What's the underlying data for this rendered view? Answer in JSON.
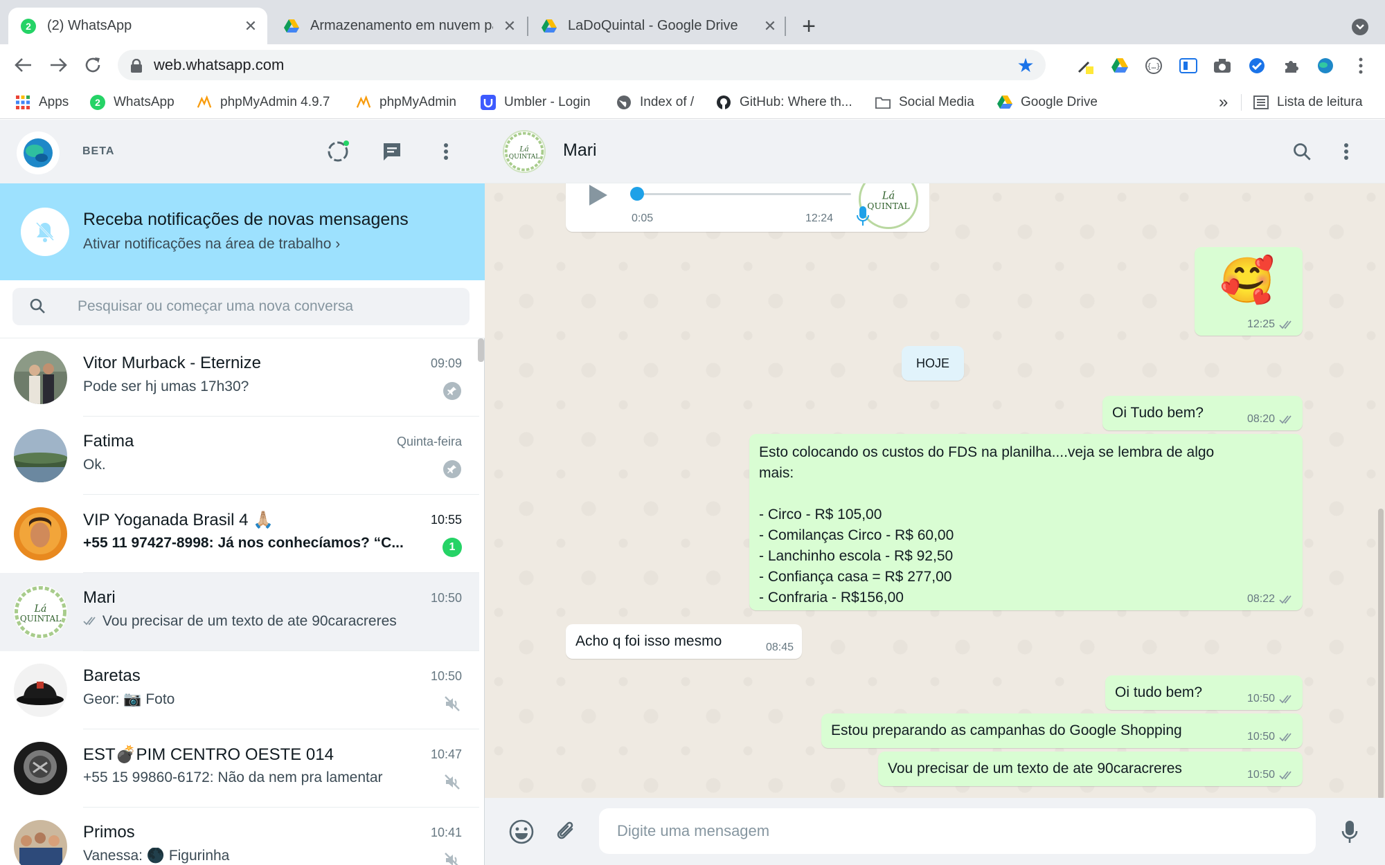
{
  "browser": {
    "tabs": [
      {
        "title": "(2) WhatsApp",
        "badge": "2",
        "active": true
      },
      {
        "title": "Armazenamento em nuvem pa"
      },
      {
        "title": "LaDoQuintal - Google Drive"
      }
    ],
    "new_tab": "+",
    "url": "web.whatsapp.com",
    "bookmarks": [
      "Apps",
      "WhatsApp",
      "phpMyAdmin 4.9.7",
      "phpMyAdmin",
      "Umbler - Login",
      "Index of /",
      "GitHub: Where th...",
      "Social Media",
      "Google Drive"
    ],
    "bookmarks_more": "»",
    "reading_list": "Lista de leitura",
    "whatsapp_badge": "2"
  },
  "sidebar": {
    "beta_label": "BETA",
    "notification": {
      "title": "Receba notificações de novas mensagens",
      "subtitle": "Ativar notificações na área de trabalho ›"
    },
    "search_placeholder": "Pesquisar ou começar uma nova conversa",
    "chats": [
      {
        "name": "Vitor Murback - Eternize",
        "time": "09:09",
        "preview": "Pode ser hj umas 17h30?",
        "meta": "pinned"
      },
      {
        "name": "Fatima",
        "time": "Quinta-feira",
        "preview": "Ok.",
        "meta": "pinned"
      },
      {
        "name": "VIP Yoganada Brasil 4 🙏🏼",
        "time": "10:55",
        "preview_sender": "+55 11 97427-8998: ",
        "preview": "Já nos conhecíamos? “C...",
        "unread": "1",
        "time_color": "#111b21"
      },
      {
        "name": "Mari",
        "time": "10:50",
        "preview": "Vou precisar de um texto de ate 90caracreres",
        "meta": "sent",
        "selected": true
      },
      {
        "name": "Baretas",
        "time": "10:50",
        "preview": "Geor: 📷 Foto",
        "meta": "muted"
      },
      {
        "name": "EST💣PIM CENTRO OESTE 014",
        "time": "10:47",
        "preview": "+55 15 99860-6172: Não da nem pra lamentar",
        "meta": "muted"
      },
      {
        "name": "Primos",
        "time": "10:41",
        "preview": "Vanessa: 🌑 Figurinha",
        "meta": "muted"
      }
    ]
  },
  "conversation": {
    "contact_name": "Mari",
    "audio": {
      "elapsed": "0:05",
      "time": "12:24"
    },
    "emoji_message": {
      "emoji": "🥰",
      "time": "12:25"
    },
    "date_divider": "HOJE",
    "messages": [
      {
        "dir": "out",
        "text": "Oi Tudo bem?",
        "time": "08:20"
      },
      {
        "dir": "out",
        "text": "Esto colocando os custos do FDS na planilha....veja se lembra de algo\nmais:\n\n- Circo - R$ 105,00\n- Comilanças Circo - R$ 60,00\n- Lanchinho escola - R$ 92,50\n- Confiança casa = R$ 277,00\n- Confraria - R$156,00",
        "time": "08:22"
      },
      {
        "dir": "in",
        "text": "Acho q foi isso mesmo",
        "time": "08:45"
      },
      {
        "dir": "out",
        "text": "Oi tudo bem?",
        "time": "10:50"
      },
      {
        "dir": "out",
        "text": "Estou preparando as campanhas do Google Shopping",
        "time": "10:50"
      },
      {
        "dir": "out",
        "text": "Vou precisar de um texto de ate 90caracreres",
        "time": "10:50"
      }
    ],
    "input_placeholder": "Digite uma mensagem"
  },
  "colors": {
    "accent_green": "#25d366",
    "outgoing_bubble": "#d9fdd3",
    "notification_banner": "#9de1fe",
    "chat_background": "#efeae2",
    "tick_blue": "#53bdeb"
  }
}
